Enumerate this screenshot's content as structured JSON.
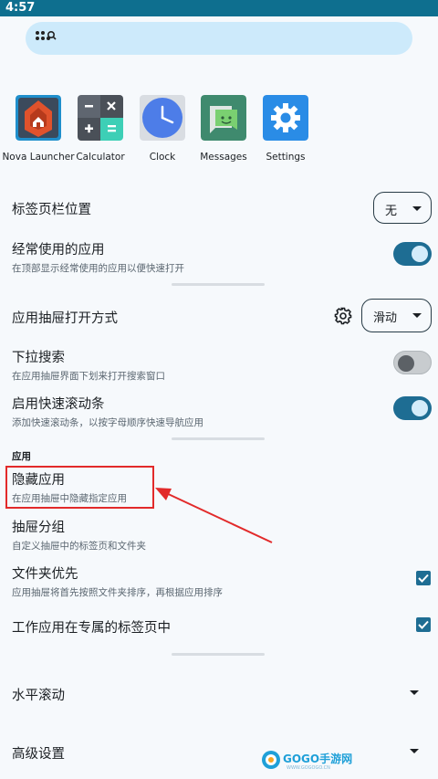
{
  "status_bar": {
    "time": "4:57"
  },
  "search": {
    "placeholder": ""
  },
  "apps": [
    {
      "label": "Nova Launcher",
      "icon": "nova-launcher-icon"
    },
    {
      "label": "Calculator",
      "icon": "calculator-icon"
    },
    {
      "label": "Clock",
      "icon": "clock-icon"
    },
    {
      "label": "Messages",
      "icon": "messages-icon"
    },
    {
      "label": "Settings",
      "icon": "settings-icon"
    }
  ],
  "settings": {
    "tab_bar_position": {
      "title": "标签页栏位置",
      "value": "无"
    },
    "frequent_apps": {
      "title": "经常使用的应用",
      "subtitle": "在顶部显示经常使用的应用以便快速打开",
      "enabled": true
    },
    "drawer_open_mode": {
      "title": "应用抽屉打开方式",
      "value": "滑动"
    },
    "pull_down_search": {
      "title": "下拉搜索",
      "subtitle": "在应用抽屉界面下划来打开搜索窗口",
      "enabled": false
    },
    "fast_scrollbar": {
      "title": "启用快速滚动条",
      "subtitle": "添加快速滚动条，以按字母顺序快速导航应用",
      "enabled": true
    },
    "apps_section_label": "应用",
    "hide_apps": {
      "title": "隐藏应用",
      "subtitle": "在应用抽屉中隐藏指定应用"
    },
    "drawer_groups": {
      "title": "抽屉分组",
      "subtitle": "自定义抽屉中的标签页和文件夹"
    },
    "folders_first": {
      "title": "文件夹优先",
      "subtitle": "应用抽屉将首先按照文件夹排序，再根据应用排序",
      "checked": true
    },
    "work_apps_tab": {
      "title": "工作应用在专属的标签页中",
      "checked": true
    },
    "horizontal_scroll": {
      "title": "水平滚动"
    },
    "advanced": {
      "title": "高级设置"
    }
  },
  "watermark": {
    "text": "GOGO手游网",
    "url": "WWW.GOGOGO.CN"
  },
  "colors": {
    "accent": "#1e6d93",
    "status_bar": "#0e6f8f",
    "search_bg": "#cdeafb",
    "highlight": "#e22a2a"
  }
}
